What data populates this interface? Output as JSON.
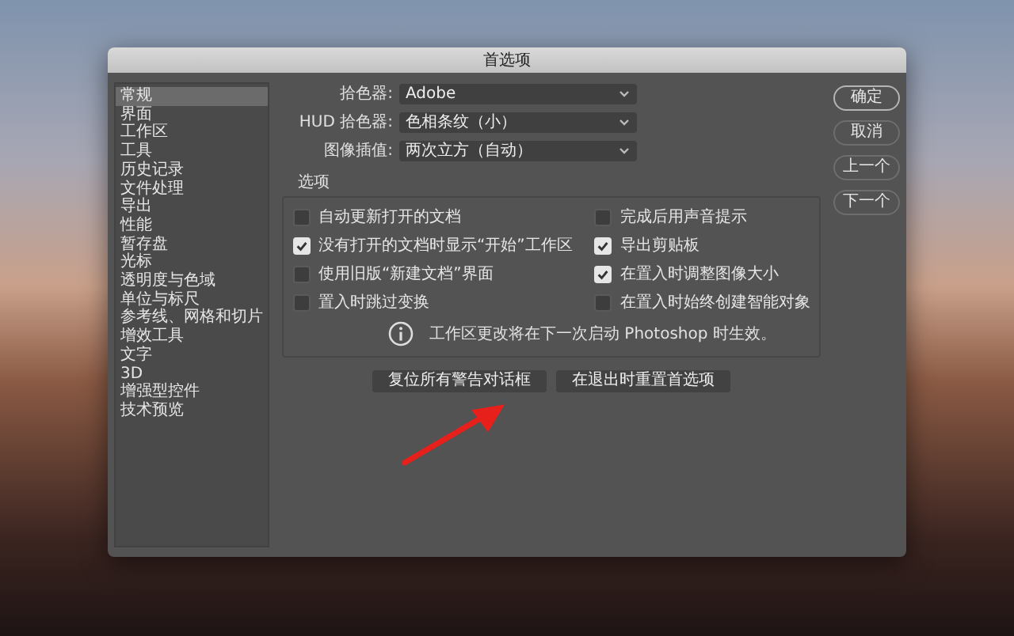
{
  "window": {
    "title": "首选项"
  },
  "sidebar": {
    "items": [
      {
        "label": "常规",
        "selected": true
      },
      {
        "label": "界面",
        "selected": false
      },
      {
        "label": "工作区",
        "selected": false
      },
      {
        "label": "工具",
        "selected": false
      },
      {
        "label": "历史记录",
        "selected": false
      },
      {
        "label": "文件处理",
        "selected": false
      },
      {
        "label": "导出",
        "selected": false
      },
      {
        "label": "性能",
        "selected": false
      },
      {
        "label": "暂存盘",
        "selected": false
      },
      {
        "label": "光标",
        "selected": false
      },
      {
        "label": "透明度与色域",
        "selected": false
      },
      {
        "label": "单位与标尺",
        "selected": false
      },
      {
        "label": "参考线、网格和切片",
        "selected": false
      },
      {
        "label": "增效工具",
        "selected": false
      },
      {
        "label": "文字",
        "selected": false
      },
      {
        "label": "3D",
        "selected": false
      },
      {
        "label": "增强型控件",
        "selected": false
      },
      {
        "label": "技术预览",
        "selected": false
      }
    ]
  },
  "fields": [
    {
      "label": "拾色器:",
      "value": "Adobe"
    },
    {
      "label": "HUD 拾色器:",
      "value": "色相条纹（小）"
    },
    {
      "label": "图像插值:",
      "value": "两次立方（自动）"
    }
  ],
  "options": {
    "title": "选项",
    "checkboxes": [
      {
        "label": "自动更新打开的文档",
        "checked": false
      },
      {
        "label": "完成后用声音提示",
        "checked": false
      },
      {
        "label": "没有打开的文档时显示“开始”工作区",
        "checked": true
      },
      {
        "label": "导出剪贴板",
        "checked": true
      },
      {
        "label": "使用旧版“新建文档”界面",
        "checked": false
      },
      {
        "label": "在置入时调整图像大小",
        "checked": true
      },
      {
        "label": "置入时跳过变换",
        "checked": false
      },
      {
        "label": "在置入时始终创建智能对象",
        "checked": false
      }
    ],
    "notice": "工作区更改将在下一次启动 Photoshop 时生效。"
  },
  "buttons": [
    "复位所有警告对话框",
    "在退出时重置首选项"
  ],
  "side_buttons": [
    "确定",
    "取消",
    "上一个",
    "下一个"
  ]
}
